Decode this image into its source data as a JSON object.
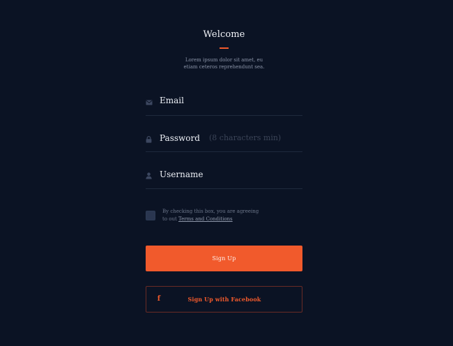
{
  "header": {
    "title": "Welcome",
    "subtitle_line_1": "Lorem ipsum dolor sit amet, eu",
    "subtitle_line_2": "etiam ceteros reprehendunt sea."
  },
  "form": {
    "email_label": "Email",
    "password_label": "Password",
    "password_hint": "(8 characters min)",
    "username_label": "Username"
  },
  "consent": {
    "line_1": "By checking this box, you are agreeing",
    "line_2_prefix": "to out ",
    "link_text": "Terms and Conditions"
  },
  "buttons": {
    "signup_label": "Sign Up",
    "facebook_label": "Sign Up with Facebook",
    "facebook_icon_glyph": "f"
  },
  "icons": {
    "email": "envelope-icon",
    "password": "lock-icon",
    "username": "user-icon",
    "facebook": "facebook-icon"
  },
  "colors": {
    "background": "#0b1324",
    "accent": "#f15a2c",
    "field_divider": "#1f2a3d",
    "muted_text": "#8a93a7"
  }
}
